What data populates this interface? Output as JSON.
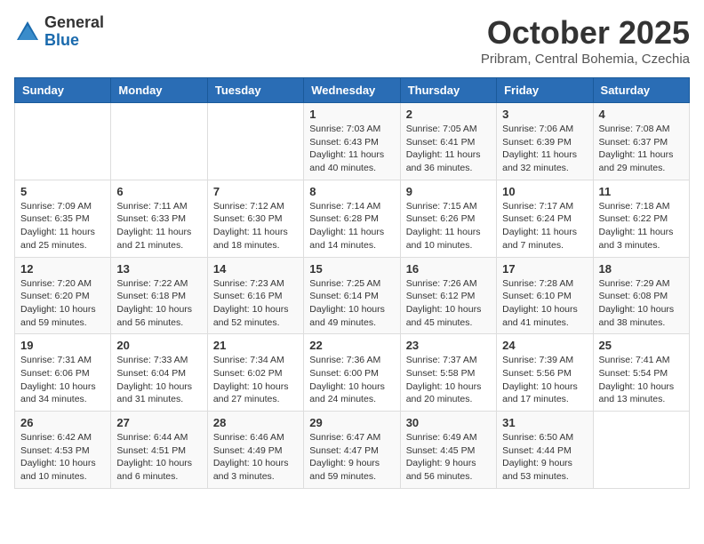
{
  "header": {
    "logo_general": "General",
    "logo_blue": "Blue",
    "month": "October 2025",
    "location": "Pribram, Central Bohemia, Czechia"
  },
  "weekdays": [
    "Sunday",
    "Monday",
    "Tuesday",
    "Wednesday",
    "Thursday",
    "Friday",
    "Saturday"
  ],
  "weeks": [
    [
      {
        "day": "",
        "info": ""
      },
      {
        "day": "",
        "info": ""
      },
      {
        "day": "",
        "info": ""
      },
      {
        "day": "1",
        "info": "Sunrise: 7:03 AM\nSunset: 6:43 PM\nDaylight: 11 hours\nand 40 minutes."
      },
      {
        "day": "2",
        "info": "Sunrise: 7:05 AM\nSunset: 6:41 PM\nDaylight: 11 hours\nand 36 minutes."
      },
      {
        "day": "3",
        "info": "Sunrise: 7:06 AM\nSunset: 6:39 PM\nDaylight: 11 hours\nand 32 minutes."
      },
      {
        "day": "4",
        "info": "Sunrise: 7:08 AM\nSunset: 6:37 PM\nDaylight: 11 hours\nand 29 minutes."
      }
    ],
    [
      {
        "day": "5",
        "info": "Sunrise: 7:09 AM\nSunset: 6:35 PM\nDaylight: 11 hours\nand 25 minutes."
      },
      {
        "day": "6",
        "info": "Sunrise: 7:11 AM\nSunset: 6:33 PM\nDaylight: 11 hours\nand 21 minutes."
      },
      {
        "day": "7",
        "info": "Sunrise: 7:12 AM\nSunset: 6:30 PM\nDaylight: 11 hours\nand 18 minutes."
      },
      {
        "day": "8",
        "info": "Sunrise: 7:14 AM\nSunset: 6:28 PM\nDaylight: 11 hours\nand 14 minutes."
      },
      {
        "day": "9",
        "info": "Sunrise: 7:15 AM\nSunset: 6:26 PM\nDaylight: 11 hours\nand 10 minutes."
      },
      {
        "day": "10",
        "info": "Sunrise: 7:17 AM\nSunset: 6:24 PM\nDaylight: 11 hours\nand 7 minutes."
      },
      {
        "day": "11",
        "info": "Sunrise: 7:18 AM\nSunset: 6:22 PM\nDaylight: 11 hours\nand 3 minutes."
      }
    ],
    [
      {
        "day": "12",
        "info": "Sunrise: 7:20 AM\nSunset: 6:20 PM\nDaylight: 10 hours\nand 59 minutes."
      },
      {
        "day": "13",
        "info": "Sunrise: 7:22 AM\nSunset: 6:18 PM\nDaylight: 10 hours\nand 56 minutes."
      },
      {
        "day": "14",
        "info": "Sunrise: 7:23 AM\nSunset: 6:16 PM\nDaylight: 10 hours\nand 52 minutes."
      },
      {
        "day": "15",
        "info": "Sunrise: 7:25 AM\nSunset: 6:14 PM\nDaylight: 10 hours\nand 49 minutes."
      },
      {
        "day": "16",
        "info": "Sunrise: 7:26 AM\nSunset: 6:12 PM\nDaylight: 10 hours\nand 45 minutes."
      },
      {
        "day": "17",
        "info": "Sunrise: 7:28 AM\nSunset: 6:10 PM\nDaylight: 10 hours\nand 41 minutes."
      },
      {
        "day": "18",
        "info": "Sunrise: 7:29 AM\nSunset: 6:08 PM\nDaylight: 10 hours\nand 38 minutes."
      }
    ],
    [
      {
        "day": "19",
        "info": "Sunrise: 7:31 AM\nSunset: 6:06 PM\nDaylight: 10 hours\nand 34 minutes."
      },
      {
        "day": "20",
        "info": "Sunrise: 7:33 AM\nSunset: 6:04 PM\nDaylight: 10 hours\nand 31 minutes."
      },
      {
        "day": "21",
        "info": "Sunrise: 7:34 AM\nSunset: 6:02 PM\nDaylight: 10 hours\nand 27 minutes."
      },
      {
        "day": "22",
        "info": "Sunrise: 7:36 AM\nSunset: 6:00 PM\nDaylight: 10 hours\nand 24 minutes."
      },
      {
        "day": "23",
        "info": "Sunrise: 7:37 AM\nSunset: 5:58 PM\nDaylight: 10 hours\nand 20 minutes."
      },
      {
        "day": "24",
        "info": "Sunrise: 7:39 AM\nSunset: 5:56 PM\nDaylight: 10 hours\nand 17 minutes."
      },
      {
        "day": "25",
        "info": "Sunrise: 7:41 AM\nSunset: 5:54 PM\nDaylight: 10 hours\nand 13 minutes."
      }
    ],
    [
      {
        "day": "26",
        "info": "Sunrise: 6:42 AM\nSunset: 4:53 PM\nDaylight: 10 hours\nand 10 minutes."
      },
      {
        "day": "27",
        "info": "Sunrise: 6:44 AM\nSunset: 4:51 PM\nDaylight: 10 hours\nand 6 minutes."
      },
      {
        "day": "28",
        "info": "Sunrise: 6:46 AM\nSunset: 4:49 PM\nDaylight: 10 hours\nand 3 minutes."
      },
      {
        "day": "29",
        "info": "Sunrise: 6:47 AM\nSunset: 4:47 PM\nDaylight: 9 hours\nand 59 minutes."
      },
      {
        "day": "30",
        "info": "Sunrise: 6:49 AM\nSunset: 4:45 PM\nDaylight: 9 hours\nand 56 minutes."
      },
      {
        "day": "31",
        "info": "Sunrise: 6:50 AM\nSunset: 4:44 PM\nDaylight: 9 hours\nand 53 minutes."
      },
      {
        "day": "",
        "info": ""
      }
    ]
  ]
}
